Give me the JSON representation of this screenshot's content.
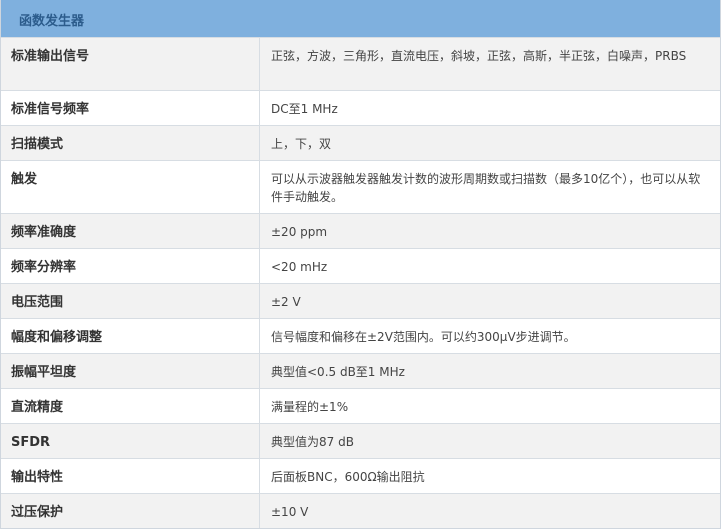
{
  "table": {
    "title": "函数发生器",
    "rows": [
      {
        "label": "标准输出信号",
        "value": "正弦，方波，三角形，直流电压，斜坡，正弦，高斯，半正弦，白噪声，PRBS"
      },
      {
        "label": "标准信号频率",
        "value": "DC至1 MHz"
      },
      {
        "label": "扫描模式",
        "value": "上，下，双"
      },
      {
        "label": "触发",
        "value": "可以从示波器触发器触发计数的波形周期数或扫描数（最多10亿个），也可以从软件手动触发。"
      },
      {
        "label": "频率准确度",
        "value": "±20 ppm"
      },
      {
        "label": "频率分辨率",
        "value": "<20 mHz"
      },
      {
        "label": "电压范围",
        "value": "±2 V"
      },
      {
        "label": "幅度和偏移调整",
        "value": "信号幅度和偏移在±2V范围内。可以约300μV步进调节。"
      },
      {
        "label": "振幅平坦度",
        "value": "典型值<0.5 dB至1 MHz"
      },
      {
        "label": "直流精度",
        "value": "满量程的±1%"
      },
      {
        "label": "SFDR",
        "value": "典型值为87 dB"
      },
      {
        "label": "输出特性",
        "value": "后面板BNC，600Ω输出阻抗"
      },
      {
        "label": "过压保护",
        "value": "±10 V"
      }
    ]
  }
}
